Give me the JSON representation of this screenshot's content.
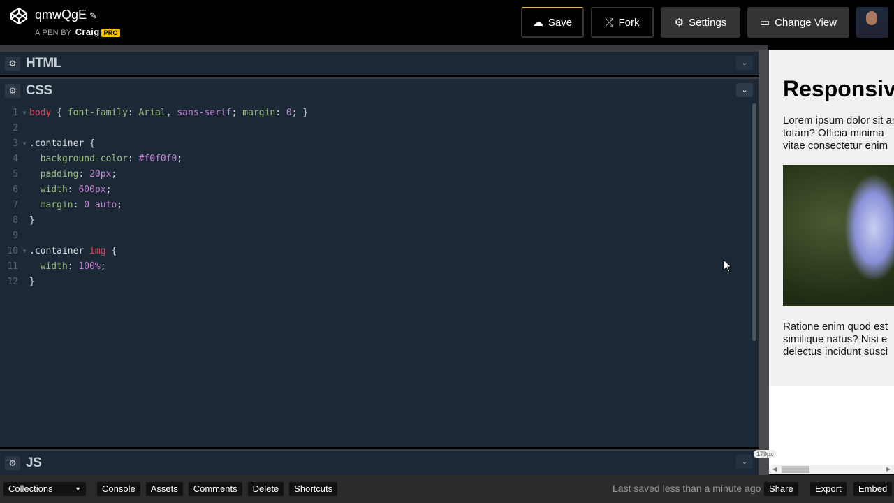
{
  "header": {
    "title": "qmwQgE",
    "byline": "A PEN BY",
    "author": "Craig",
    "badge": "PRO",
    "buttons": {
      "save": "Save",
      "fork": "Fork",
      "settings": "Settings",
      "change_view": "Change View"
    }
  },
  "panes": {
    "html": "HTML",
    "css": "CSS",
    "js": "JS"
  },
  "css_code": [
    [
      [
        "body",
        "sel"
      ],
      [
        " { ",
        "p"
      ],
      [
        "font-family",
        "prop"
      ],
      [
        ": ",
        "p"
      ],
      [
        "Arial",
        "prop"
      ],
      [
        ", ",
        "p"
      ],
      [
        "sans-serif",
        "val"
      ],
      [
        "; ",
        "p"
      ],
      [
        "margin",
        "prop"
      ],
      [
        ": ",
        "p"
      ],
      [
        "0",
        "val"
      ],
      [
        "; }",
        "p"
      ]
    ],
    [],
    [
      [
        ".container",
        "cls"
      ],
      [
        " {",
        "p"
      ]
    ],
    [
      [
        "  background-color",
        "prop"
      ],
      [
        ": ",
        "p"
      ],
      [
        "#f0f0f0",
        "val"
      ],
      [
        ";",
        "p"
      ]
    ],
    [
      [
        "  padding",
        "prop"
      ],
      [
        ": ",
        "p"
      ],
      [
        "20px",
        "val"
      ],
      [
        ";",
        "p"
      ]
    ],
    [
      [
        "  width",
        "prop"
      ],
      [
        ": ",
        "p"
      ],
      [
        "600px",
        "val"
      ],
      [
        ";",
        "p"
      ]
    ],
    [
      [
        "  margin",
        "prop"
      ],
      [
        ": ",
        "p"
      ],
      [
        "0 auto",
        "val"
      ],
      [
        ";",
        "p"
      ]
    ],
    [
      [
        "}",
        "b"
      ]
    ],
    [],
    [
      [
        ".container ",
        "cls"
      ],
      [
        "img",
        "sel"
      ],
      [
        " {",
        "p"
      ]
    ],
    [
      [
        "  width",
        "prop"
      ],
      [
        ": ",
        "p"
      ],
      [
        "100%",
        "val"
      ],
      [
        ";",
        "p"
      ]
    ],
    [
      [
        "}",
        "b"
      ]
    ]
  ],
  "folds": [
    1,
    3,
    10
  ],
  "preview": {
    "heading": "Responsive",
    "para1": [
      "Lorem ipsum dolor sit amet",
      "totam? Officia minima",
      "vitae consectetur enim"
    ],
    "para2": [
      "Ratione enim quod est",
      "similique natus? Nisi e",
      "delectus incidunt susci"
    ],
    "width_label": "179px"
  },
  "footer": {
    "collections": "Collections",
    "console": "Console",
    "assets": "Assets",
    "comments": "Comments",
    "delete": "Delete",
    "shortcuts": "Shortcuts",
    "status": "Last saved less than a minute ago",
    "share": "Share",
    "export": "Export",
    "embed": "Embed"
  }
}
